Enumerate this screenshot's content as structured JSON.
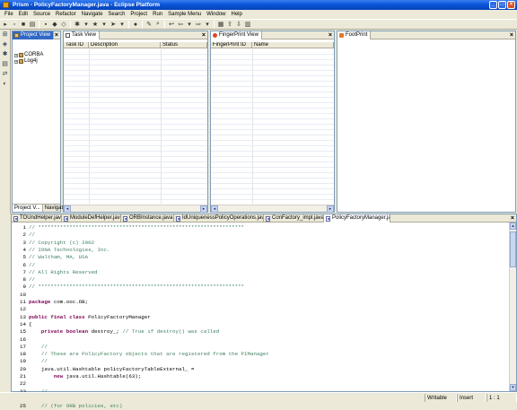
{
  "window": {
    "title": "Prism - PolicyFactoryManager.java - Eclipse Platform",
    "controls": [
      "_",
      "□",
      "×"
    ]
  },
  "menu": [
    "File",
    "Edit",
    "Source",
    "Refactor",
    "Navigate",
    "Search",
    "Project",
    "Run",
    "Sample Menu",
    "Window",
    "Help"
  ],
  "project_view": {
    "title": "Project View",
    "items": [
      "CORBA",
      "Log4j"
    ],
    "bottom_tabs": [
      "Project V...",
      "Navigator"
    ]
  },
  "task_view": {
    "title": "Task View",
    "columns": [
      "Task ID",
      "Description",
      "Status"
    ]
  },
  "fingerprint_view": {
    "title": "FingerPrint View",
    "columns": [
      "FingerPrint ID",
      "Name"
    ]
  },
  "footprint_view": {
    "title": "FootPrint"
  },
  "editor": {
    "tabs": [
      "TOUndHelper.java",
      "ModuleDefHelper.java",
      "ORBInstance.java",
      "IdUniquenessPolicyOperations.java",
      "ConFactory_impl.java",
      "PolicyFactoryManager.java"
    ],
    "active_tab": 5,
    "lines": [
      {
        "n": "1",
        "segs": [
          {
            "c": "cm",
            "t": "// ******************************************************************"
          }
        ]
      },
      {
        "n": "2",
        "segs": [
          {
            "c": "cm",
            "t": "//"
          }
        ]
      },
      {
        "n": "3",
        "segs": [
          {
            "c": "cm",
            "t": "// Copyright (c) 2002"
          }
        ]
      },
      {
        "n": "4",
        "segs": [
          {
            "c": "cm",
            "t": "// IONA Technologies, Inc."
          }
        ]
      },
      {
        "n": "5",
        "segs": [
          {
            "c": "cm",
            "t": "// Waltham, MA, USA"
          }
        ]
      },
      {
        "n": "6",
        "segs": [
          {
            "c": "cm",
            "t": "//"
          }
        ]
      },
      {
        "n": "7",
        "segs": [
          {
            "c": "cm",
            "t": "// All Rights Reserved"
          }
        ]
      },
      {
        "n": "8",
        "segs": [
          {
            "c": "cm",
            "t": "//"
          }
        ]
      },
      {
        "n": "9",
        "segs": [
          {
            "c": "cm",
            "t": "// ******************************************************************"
          }
        ]
      },
      {
        "n": "10",
        "segs": [
          {
            "c": "",
            "t": ""
          }
        ]
      },
      {
        "n": "11",
        "segs": [
          {
            "c": "kw",
            "t": "package"
          },
          {
            "c": "",
            "t": " com.ooc.OB;"
          }
        ]
      },
      {
        "n": "12",
        "segs": [
          {
            "c": "",
            "t": ""
          }
        ]
      },
      {
        "n": "13",
        "segs": [
          {
            "c": "kw",
            "t": "public final class"
          },
          {
            "c": "",
            "t": " PolicyFactoryManager"
          }
        ]
      },
      {
        "n": "14",
        "segs": [
          {
            "c": "",
            "t": "{"
          }
        ]
      },
      {
        "n": "15",
        "segs": [
          {
            "c": "",
            "t": "    "
          },
          {
            "c": "kw",
            "t": "private boolean"
          },
          {
            "c": "",
            "t": " destroy_; "
          },
          {
            "c": "cm",
            "t": "// True if destroy() was called"
          }
        ]
      },
      {
        "n": "16",
        "segs": [
          {
            "c": "",
            "t": ""
          }
        ]
      },
      {
        "n": "17",
        "segs": [
          {
            "c": "",
            "t": "    "
          },
          {
            "c": "cm",
            "t": "//"
          }
        ]
      },
      {
        "n": "18",
        "segs": [
          {
            "c": "",
            "t": "    "
          },
          {
            "c": "cm",
            "t": "// These are PolicyFactory objects that are registered from the PIManager"
          }
        ]
      },
      {
        "n": "19",
        "segs": [
          {
            "c": "",
            "t": "    "
          },
          {
            "c": "cm",
            "t": "//"
          }
        ]
      },
      {
        "n": "20",
        "segs": [
          {
            "c": "",
            "t": "    java.util.Hashtable policyFactoryTableExternal_ ="
          }
        ]
      },
      {
        "n": "21",
        "segs": [
          {
            "c": "",
            "t": "        "
          },
          {
            "c": "kw",
            "t": "new"
          },
          {
            "c": "",
            "t": " java.util.Hashtable(63);"
          }
        ]
      },
      {
        "n": "22",
        "segs": [
          {
            "c": "",
            "t": ""
          }
        ]
      },
      {
        "n": "23",
        "segs": [
          {
            "c": "",
            "t": "    "
          },
          {
            "c": "cm",
            "t": "//"
          }
        ]
      },
      {
        "n": "24",
        "segs": [
          {
            "c": "",
            "t": "    "
          },
          {
            "c": "cm",
            "t": "// These are PolicyFactory objects that are registered internally"
          }
        ]
      },
      {
        "n": "25",
        "segs": [
          {
            "c": "",
            "t": "    "
          },
          {
            "c": "cm",
            "t": "// (for ORB policies, etc)"
          }
        ]
      }
    ]
  },
  "status": {
    "writable": "Writable",
    "insert": "Insert",
    "position": "1 : 1"
  },
  "colors": {
    "titlebar": "#0A55DA",
    "active_view_tab": "#3169C6",
    "comment": "#3F7F5F",
    "keyword": "#7F0055"
  }
}
